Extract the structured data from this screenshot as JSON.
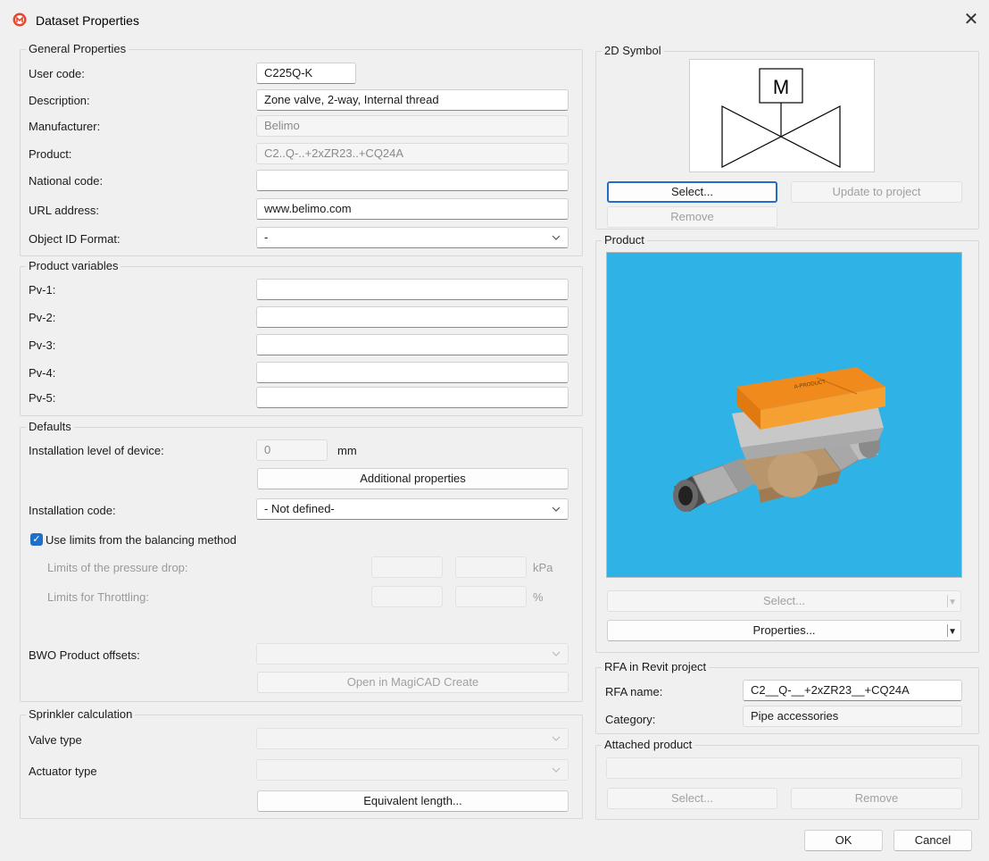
{
  "window": {
    "title": "Dataset Properties",
    "close_glyph": "✕"
  },
  "general": {
    "title": "General Properties",
    "user_code_label": "User code:",
    "user_code_value": "C225Q-K",
    "description_label": "Description:",
    "description_value": "Zone valve, 2-way, Internal thread",
    "manufacturer_label": "Manufacturer:",
    "manufacturer_value": "Belimo",
    "product_label": "Product:",
    "product_value": "C2..Q-..+2xZR23..+CQ24A",
    "national_code_label": "National code:",
    "national_code_value": "",
    "url_label": "URL address:",
    "url_value": "www.belimo.com",
    "object_id_label": "Object ID Format:",
    "object_id_value": "-"
  },
  "product_variables": {
    "title": "Product variables",
    "items": [
      {
        "label": "Pv-1:",
        "value": ""
      },
      {
        "label": "Pv-2:",
        "value": ""
      },
      {
        "label": "Pv-3:",
        "value": ""
      },
      {
        "label": "Pv-4:",
        "value": ""
      },
      {
        "label": "Pv-5:",
        "value": ""
      }
    ]
  },
  "defaults": {
    "title": "Defaults",
    "install_level_label": "Installation level of device:",
    "install_level_value": "0",
    "install_level_unit": "mm",
    "additional_button": "Additional properties",
    "install_code_label": "Installation code:",
    "install_code_value": "- Not defined-",
    "use_limits_label": "Use limits from the balancing method",
    "use_limits_checked": true,
    "pressure_drop_label": "Limits of the pressure drop:",
    "pressure_drop_unit": "kPa",
    "throttling_label": "Limits for Throttling:",
    "throttling_unit": "%",
    "bwo_label": "BWO Product offsets:",
    "bwo_value": "",
    "open_magicad_button": "Open in MagiCAD Create"
  },
  "sprinkler": {
    "title": "Sprinkler calculation",
    "valve_type_label": "Valve type",
    "actuator_type_label": "Actuator type",
    "equivalent_button": "Equivalent length..."
  },
  "symbol2d": {
    "title": "2D Symbol",
    "symbol_letter": "M",
    "select_button": "Select...",
    "update_button": "Update to project",
    "remove_button": "Remove"
  },
  "product": {
    "title": "Product",
    "background_color": "#2fb2e6",
    "actuator_label": "A-PRODUCT",
    "select_button": "Select...",
    "properties_button": "Properties..."
  },
  "rfa": {
    "title": "RFA in Revit project",
    "name_label": "RFA name:",
    "name_value": "C2__Q-__+2xZR23__+CQ24A",
    "category_label": "Category:",
    "category_value": "Pipe accessories"
  },
  "attached": {
    "title": "Attached product",
    "value": "",
    "select_button": "Select...",
    "remove_button": "Remove"
  },
  "footer": {
    "ok": "OK",
    "cancel": "Cancel"
  }
}
